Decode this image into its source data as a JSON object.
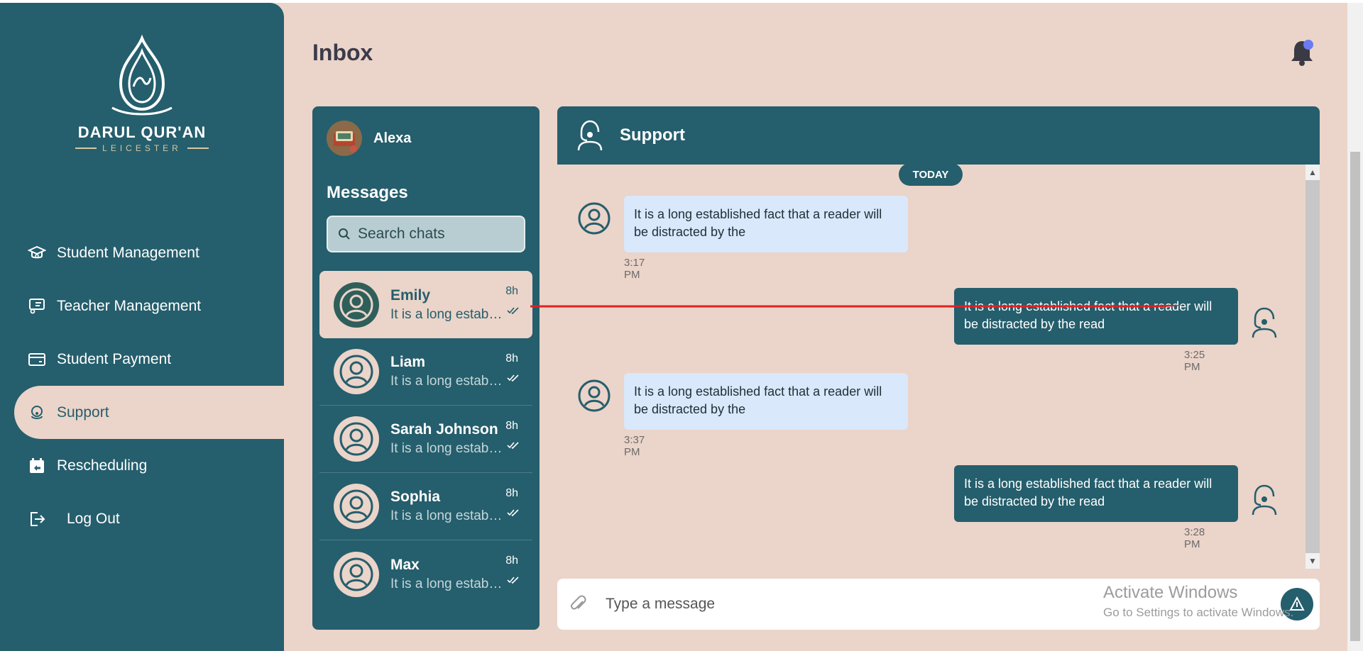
{
  "brand": {
    "name": "DARUL QUR'AN",
    "subtitle": "LEICESTER"
  },
  "sidebar": {
    "items": [
      {
        "label": "Student Management",
        "icon": "graduation-cap-icon"
      },
      {
        "label": "Teacher Management",
        "icon": "teacher-board-icon"
      },
      {
        "label": "Student Payment",
        "icon": "credit-card-icon"
      },
      {
        "label": "Support",
        "icon": "support-agent-icon",
        "active": true
      },
      {
        "label": "Rescheduling",
        "icon": "calendar-icon"
      },
      {
        "label": "Log Out",
        "icon": "logout-icon"
      }
    ]
  },
  "header": {
    "title": "Inbox",
    "notification_icon": "bell-icon"
  },
  "chat_list": {
    "user_name": "Alexa",
    "section_title": "Messages",
    "search_placeholder": "Search chats",
    "chats": [
      {
        "name": "Emily",
        "preview": "It is a long established fact that a reader will be distracted by the",
        "time": "8h",
        "active": true
      },
      {
        "name": "Liam",
        "preview": "It is a long established fact that a reader will be distracted by the",
        "time": "8h"
      },
      {
        "name": "Sarah Johnson",
        "preview": "It is a long established fact that a reader will be distracted by the",
        "time": "8h"
      },
      {
        "name": "Sophia",
        "preview": "It is a long established fact that a reader will be distracted by the",
        "time": "8h"
      },
      {
        "name": "Max",
        "preview": "It is a long established fact that a reader will be distracted by the",
        "time": "8h"
      }
    ]
  },
  "conversation": {
    "title": "Support",
    "day_label": "TODAY",
    "messages": [
      {
        "direction": "in",
        "text": "It is a long established fact that a reader will be distracted by the",
        "time": "3:17 PM"
      },
      {
        "direction": "out",
        "text": "It is a long established fact that a reader will be distracted by the read",
        "time": "3:25 PM"
      },
      {
        "direction": "in",
        "text": "It is a long established fact that a reader will be distracted by the",
        "time": "3:37 PM"
      },
      {
        "direction": "out",
        "text": "It is a long established fact that a reader will be distracted by the read",
        "time": "3:28 PM"
      }
    ]
  },
  "composer": {
    "placeholder": "Type a message"
  },
  "watermark": {
    "line1": "Activate Windows",
    "line2": "Go to Settings to activate Windows."
  },
  "colors": {
    "primary": "#255e6c",
    "background": "#ebd4c9",
    "incoming_bubble": "#d9e8fb",
    "annotation_line": "#e02020"
  }
}
